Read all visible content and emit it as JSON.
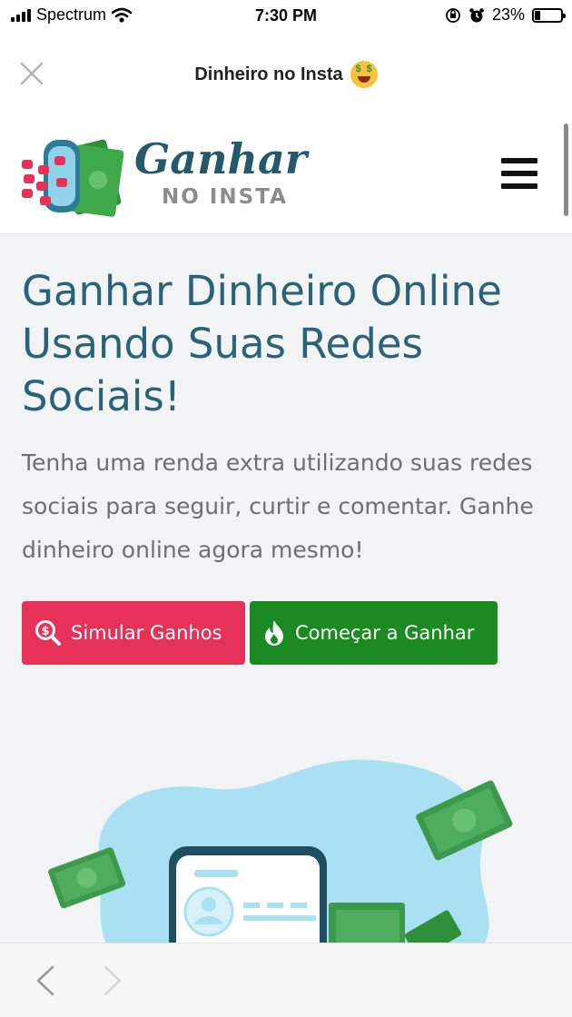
{
  "status_bar": {
    "carrier": "Spectrum",
    "time": "7:30 PM",
    "battery_percent": "23%",
    "battery_level": 0.23
  },
  "app_header": {
    "title": "Dinheiro no Insta",
    "close_icon": "close-icon",
    "title_emoji": "money-mouth-face-emoji"
  },
  "site_header": {
    "logo_word1": "Ganhar",
    "logo_word2": "NO INSTA",
    "menu_icon": "hamburger-menu-icon"
  },
  "hero": {
    "headline": "Ganhar Dinheiro Online Usando Suas Redes Sociais!",
    "subtext": "Tenha uma renda extra utilizando suas redes sociais para seguir, curtir e comentar. Ganhe dinheiro online agora mesmo!",
    "buttons": [
      {
        "label": "Simular Ganhos",
        "icon": "search-dollar-icon",
        "color": "#e63158"
      },
      {
        "label": "Começar a Ganhar",
        "icon": "fire-icon",
        "color": "#1b8a22"
      }
    ]
  },
  "bottom_nav": {
    "back_icon": "chevron-left-icon",
    "forward_icon": "chevron-right-icon"
  },
  "colors": {
    "headline": "#2a6277",
    "subtext": "#6f6f6f",
    "hero_bg": "#f2f3f5",
    "illustration_blob": "#a9e1f3",
    "money_green": "#3d9a4d"
  }
}
